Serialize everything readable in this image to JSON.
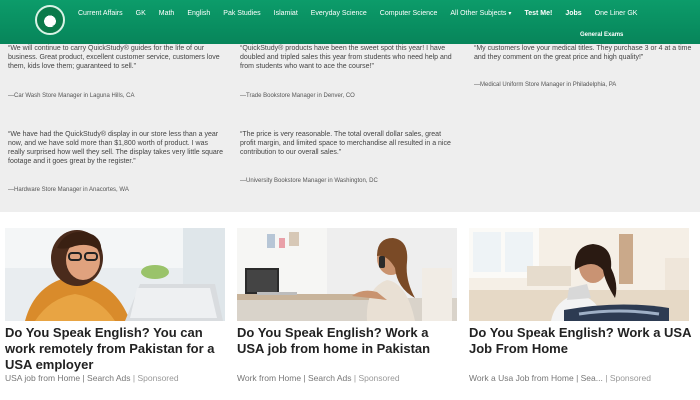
{
  "nav": {
    "items": [
      {
        "label": "Current Affairs",
        "bold": false
      },
      {
        "label": "GK",
        "bold": false
      },
      {
        "label": "Math",
        "bold": false
      },
      {
        "label": "English",
        "bold": false
      },
      {
        "label": "Pak Studies",
        "bold": false
      },
      {
        "label": "Islamiat",
        "bold": false
      },
      {
        "label": "Everyday Science",
        "bold": false
      },
      {
        "label": "Computer Science",
        "bold": false
      },
      {
        "label": "All Other Subjects",
        "bold": false,
        "dropdown": true
      },
      {
        "label": "Test Me!",
        "bold": true
      },
      {
        "label": "Jobs",
        "bold": true
      },
      {
        "label": "One Liner GK",
        "bold": false
      }
    ],
    "sub_item": "General Exams",
    "brand_color": "#0c9c6a"
  },
  "testimonials": [
    {
      "quote": "“We will continue to carry QuickStudy® guides for the life of our business. Great product, excellent customer service, customers love them, kids love them; guaranteed to sell.”",
      "author": "—Car Wash Store Manager in Laguna Hills, CA"
    },
    {
      "quote": "“QuickStudy® products have been the sweet spot this year! I have doubled and tripled sales this year from students who need help and from students who want to ace the course!”",
      "author": "—Trade Bookstore Manager in Denver, CO"
    },
    {
      "quote": "“My customers love your medical titles. They purchase 3 or 4 at a time and they comment on the great price and high quality!”",
      "author": "—Medical Uniform Store Manager in Philadelphia, PA"
    },
    {
      "quote": "“We have had the QuickStudy® display in our store less than a year now, and we have sold more than $1,800 worth of product. I was really surprised how well they sell. The display takes very little square footage and it goes great by the register.”",
      "author": "—Hardware Store Manager in Anacortes, WA"
    },
    {
      "quote": "“The price is very reasonable. The total overall dollar sales, great profit margin, and limited space to merchandise all resulted in a nice contribution to our overall sales.”",
      "author": "—University Bookstore Manager in Washington, DC"
    }
  ],
  "ads": [
    {
      "title": "Do You Speak English? You can work remotely from Pakistan for a USA employer",
      "source": "USA job from Home | Search Ads",
      "sponsored": "Sponsored"
    },
    {
      "title": "Do You Speak English? Work a USA job from home in Pakistan",
      "source": "Work from Home | Search Ads",
      "sponsored": "Sponsored"
    },
    {
      "title": "Do You Speak English? Work a USA Job From Home",
      "source": "Work a Usa Job from Home | Sea...",
      "sponsored": "Sponsored"
    }
  ]
}
